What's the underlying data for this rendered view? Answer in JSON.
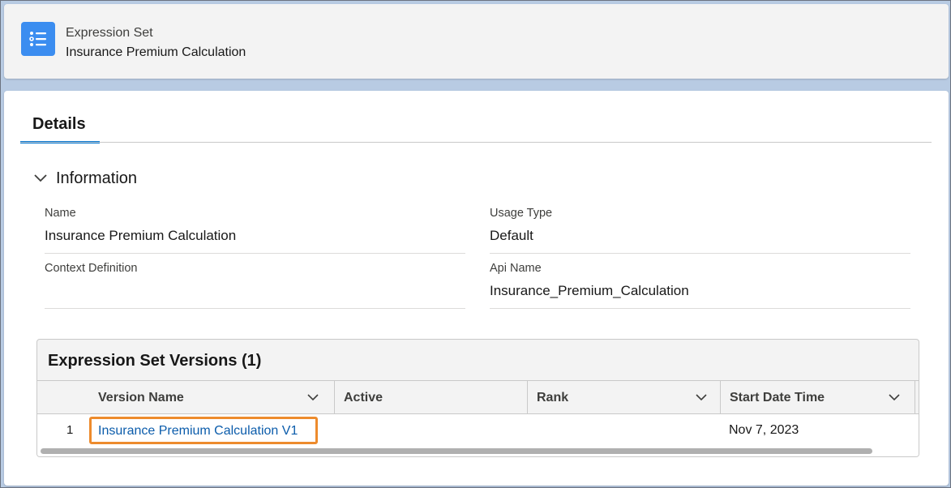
{
  "header": {
    "object_type": "Expression Set",
    "record_name": "Insurance Premium Calculation",
    "icon": "list-icon"
  },
  "tabs": [
    {
      "label": "Details",
      "active": true
    }
  ],
  "section": {
    "title": "Information",
    "expanded": true
  },
  "fields": {
    "name": {
      "label": "Name",
      "value": "Insurance Premium Calculation"
    },
    "usage_type": {
      "label": "Usage Type",
      "value": "Default"
    },
    "context_definition": {
      "label": "Context Definition",
      "value": ""
    },
    "api_name": {
      "label": "Api Name",
      "value": "Insurance_Premium_Calculation"
    }
  },
  "related_list": {
    "title": "Expression Set Versions (1)",
    "columns": [
      "Version Name",
      "Active",
      "Rank",
      "Start Date Time"
    ],
    "rows": [
      {
        "num": "1",
        "version_name": "Insurance Premium Calculation V1",
        "active": "",
        "rank": "",
        "start_date_time": "Nov 7, 2023"
      }
    ]
  },
  "colors": {
    "brand_blue": "#0176d3",
    "icon_blue": "#3b8df0",
    "link": "#0b5cab",
    "highlight": "#ed8b2d"
  }
}
